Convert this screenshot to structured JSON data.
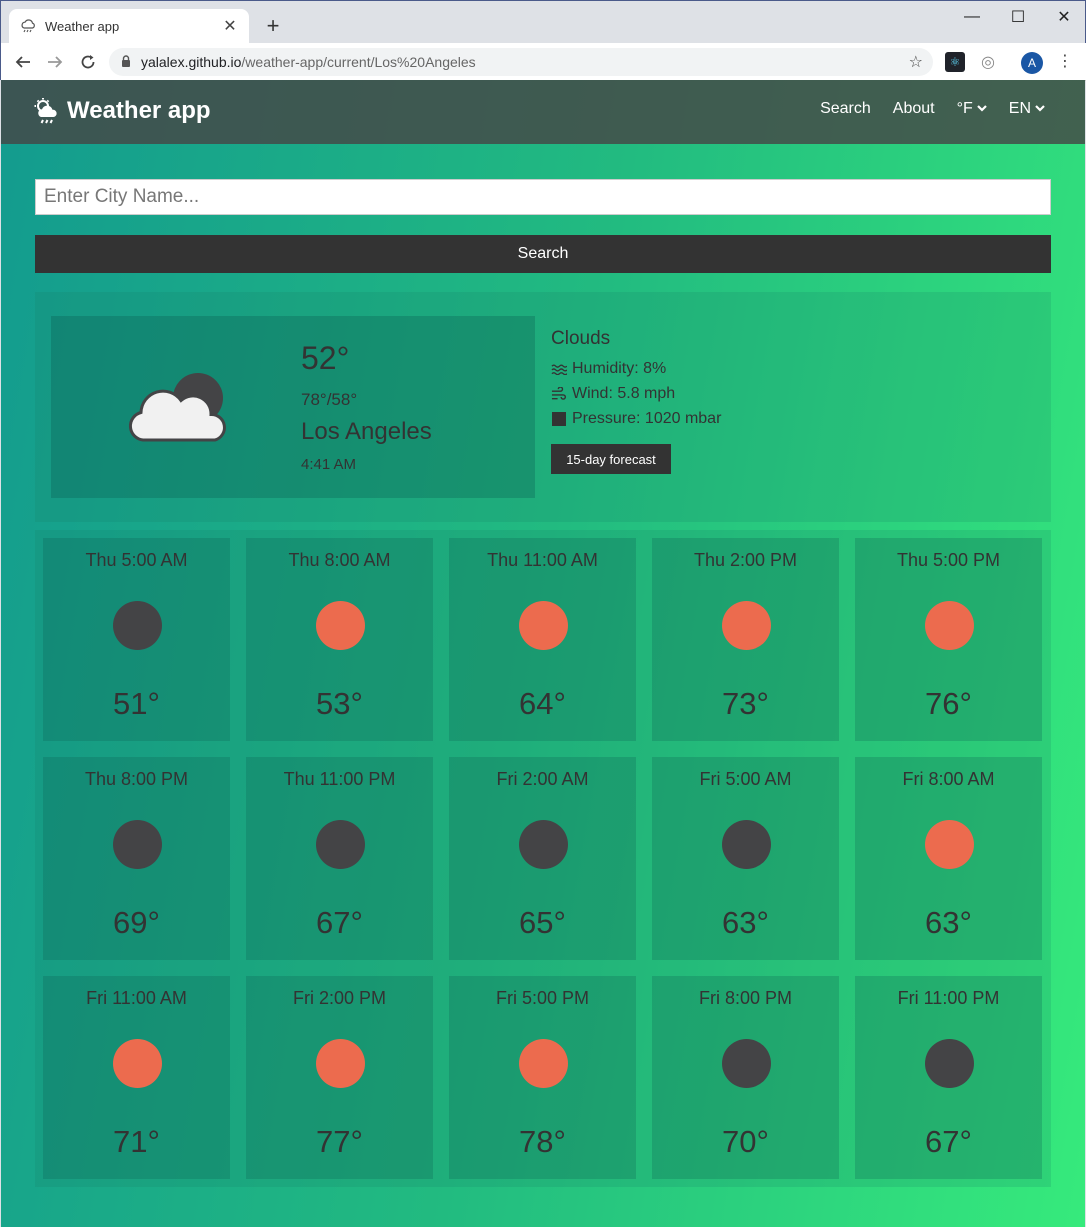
{
  "browser": {
    "tab_title": "Weather app",
    "tab_icon": "cloud-rain-icon",
    "url_host": "yalalex.github.io",
    "url_path": "/weather-app/current/Los%20Angeles",
    "profile_initial": "A"
  },
  "navbar": {
    "brand": "Weather app",
    "brand_icon": "cloud-sun-rain-icon",
    "search_label": "Search",
    "about_label": "About",
    "units_label": "°F",
    "language_label": "EN"
  },
  "search": {
    "placeholder": "Enter City Name...",
    "value": "",
    "button_label": "Search"
  },
  "current": {
    "icon": "cloud-moon-icon",
    "temp": "52°",
    "range": "78°/58°",
    "city": "Los Angeles",
    "time": "4:41 AM",
    "condition": "Clouds",
    "humidity": "Humidity: 8%",
    "wind": "Wind: 5.8 mph",
    "pressure": "Pressure: 1020 mbar",
    "forecast_button": "15-day forecast"
  },
  "colors": {
    "sun": "#ec6b4e",
    "moon": "#444446",
    "gradient_start": "#139b8f",
    "gradient_end": "#36ea7c",
    "button": "#333333"
  },
  "hourly": [
    {
      "time": "Thu 5:00 AM",
      "icon": "moon",
      "temp": "51°"
    },
    {
      "time": "Thu 8:00 AM",
      "icon": "sun",
      "temp": "53°"
    },
    {
      "time": "Thu 11:00 AM",
      "icon": "sun",
      "temp": "64°"
    },
    {
      "time": "Thu 2:00 PM",
      "icon": "sun",
      "temp": "73°"
    },
    {
      "time": "Thu 5:00 PM",
      "icon": "sun",
      "temp": "76°"
    },
    {
      "time": "Thu 8:00 PM",
      "icon": "moon",
      "temp": "69°"
    },
    {
      "time": "Thu 11:00 PM",
      "icon": "moon",
      "temp": "67°"
    },
    {
      "time": "Fri 2:00 AM",
      "icon": "moon",
      "temp": "65°"
    },
    {
      "time": "Fri 5:00 AM",
      "icon": "moon",
      "temp": "63°"
    },
    {
      "time": "Fri 8:00 AM",
      "icon": "sun",
      "temp": "63°"
    },
    {
      "time": "Fri 11:00 AM",
      "icon": "sun",
      "temp": "71°"
    },
    {
      "time": "Fri 2:00 PM",
      "icon": "sun",
      "temp": "77°"
    },
    {
      "time": "Fri 5:00 PM",
      "icon": "sun",
      "temp": "78°"
    },
    {
      "time": "Fri 8:00 PM",
      "icon": "moon",
      "temp": "70°"
    },
    {
      "time": "Fri 11:00 PM",
      "icon": "moon",
      "temp": "67°"
    }
  ]
}
